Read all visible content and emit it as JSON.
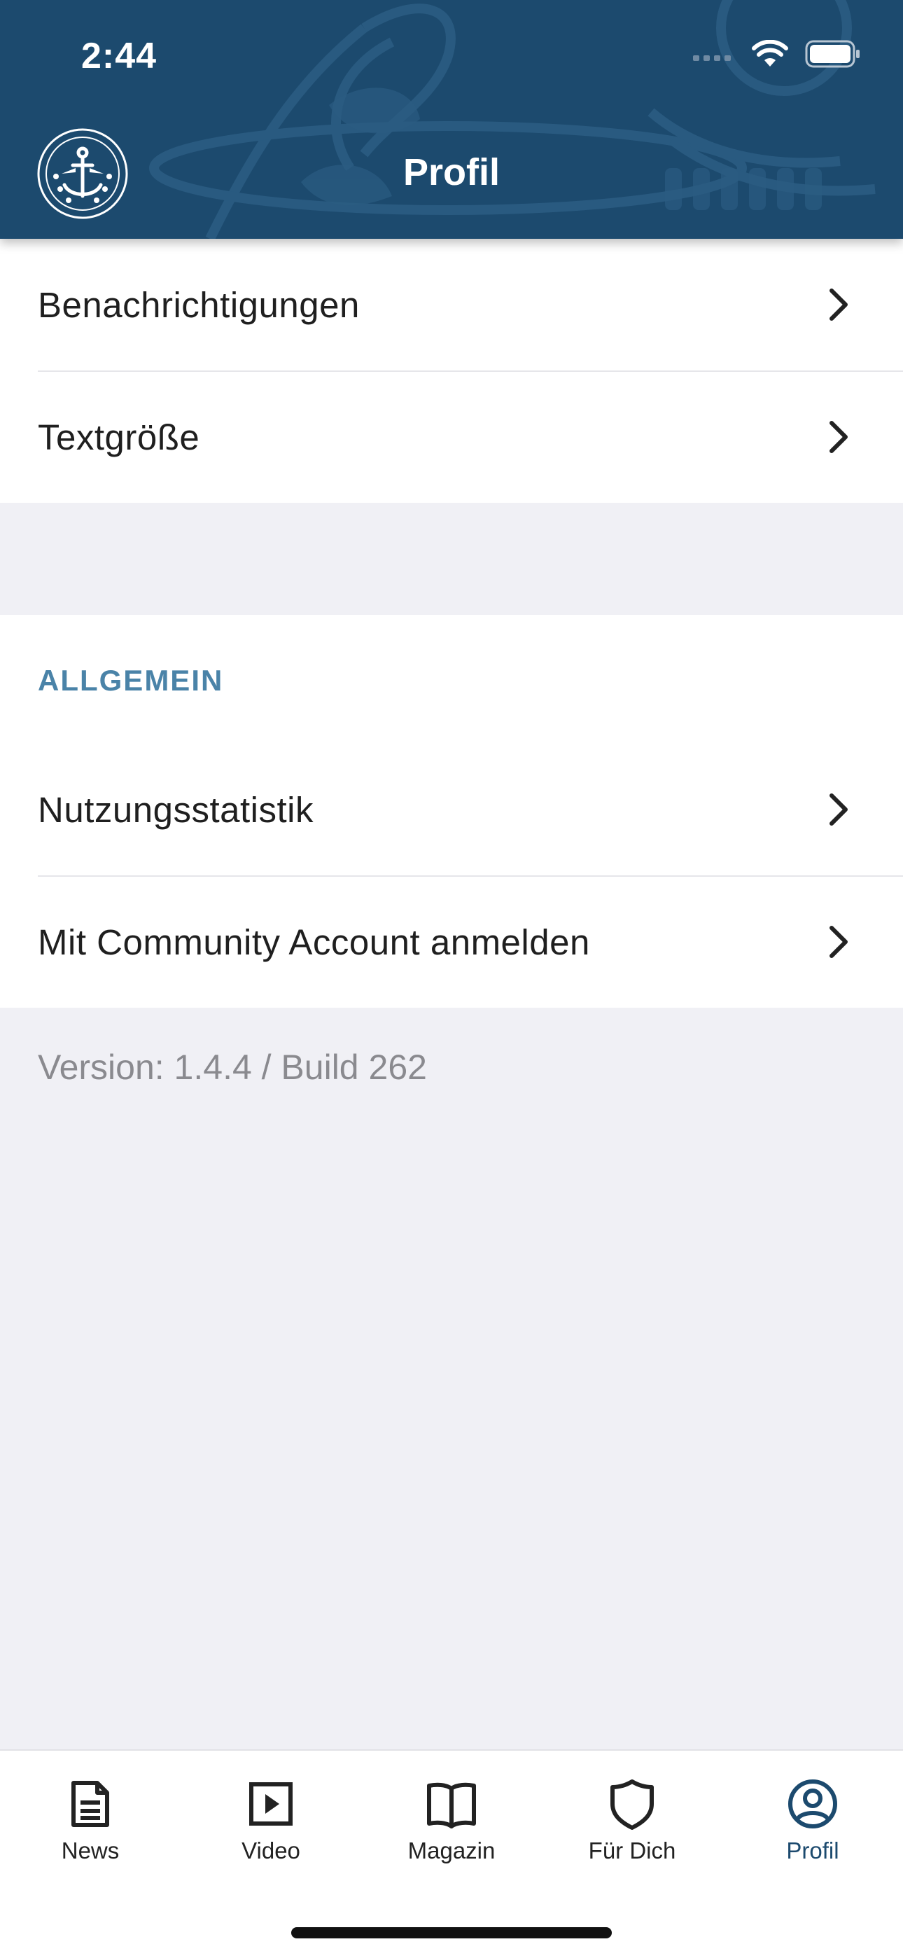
{
  "status_bar": {
    "time": "2:44"
  },
  "header": {
    "title": "Profil",
    "logo_icon": "navy-anchor-emblem-icon",
    "background_color": "#1c4a6e"
  },
  "settings": {
    "items": [
      {
        "label": "Benachrichtigungen",
        "icon": "chevron-right-icon"
      },
      {
        "label": "Textgröße",
        "icon": "chevron-right-icon"
      }
    ]
  },
  "general": {
    "heading": "ALLGEMEIN",
    "heading_color": "#4a83a8",
    "items": [
      {
        "label": "Nutzungsstatistik",
        "icon": "chevron-right-icon"
      },
      {
        "label": "Mit Community Account anmelden",
        "icon": "chevron-right-icon"
      }
    ]
  },
  "version_text": "Version: 1.4.4 / Build 262",
  "tabbar": {
    "active_color": "#1c4a6e",
    "tabs": [
      {
        "label": "News",
        "icon": "news-icon"
      },
      {
        "label": "Video",
        "icon": "video-play-icon"
      },
      {
        "label": "Magazin",
        "icon": "book-icon"
      },
      {
        "label": "Für Dich",
        "icon": "shield-icon"
      },
      {
        "label": "Profil",
        "icon": "profile-icon",
        "active": true
      }
    ]
  }
}
